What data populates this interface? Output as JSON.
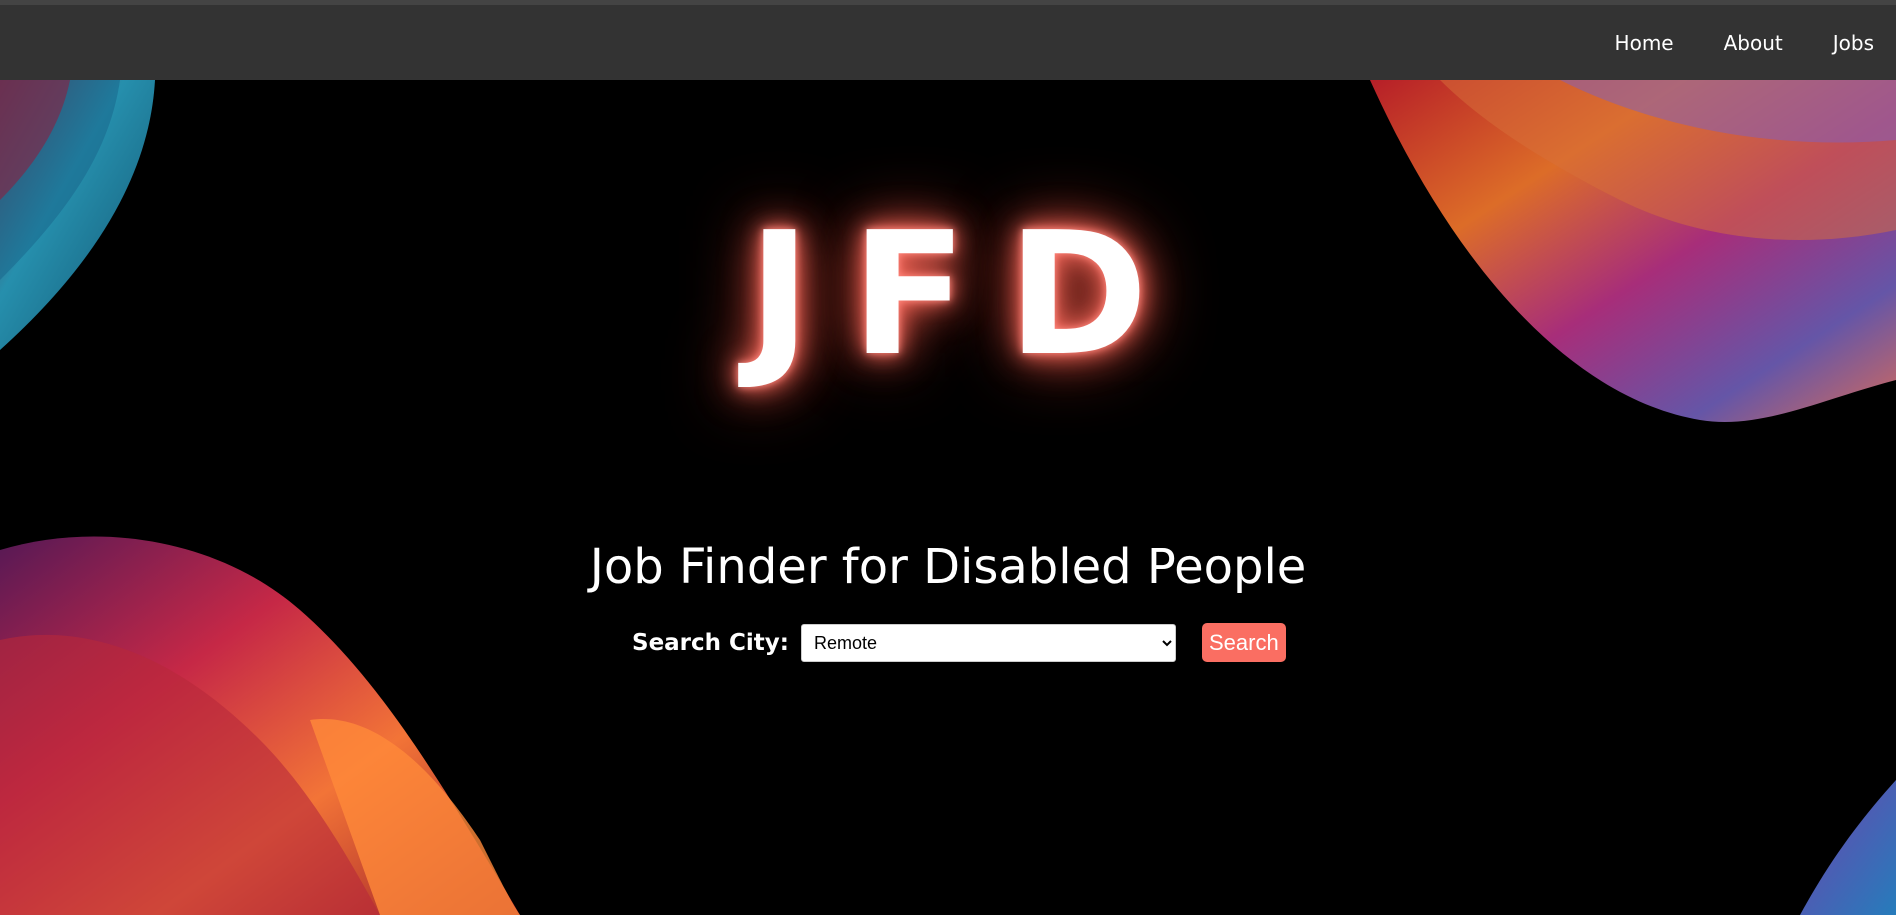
{
  "nav": {
    "items": [
      "Home",
      "About",
      "Jobs"
    ]
  },
  "hero": {
    "logo": "JFD",
    "tagline": "Job Finder for Disabled People"
  },
  "search": {
    "label": "Search City:",
    "selected_city": "Remote",
    "button_label": "Search"
  },
  "colors": {
    "topbar": "#333333",
    "background": "#000000",
    "accent": "#fa6e62"
  }
}
